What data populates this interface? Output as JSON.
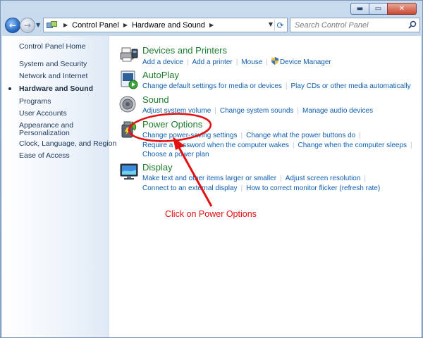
{
  "window": {
    "buttons": {
      "minimize": "▬",
      "maximize": "▭",
      "close": "✕"
    }
  },
  "address": {
    "crumbs": [
      "Control Panel",
      "Hardware and Sound"
    ],
    "search_placeholder": "Search Control Panel"
  },
  "sidebar": {
    "items": [
      {
        "label": "Control Panel Home"
      },
      {
        "label": "System and Security"
      },
      {
        "label": "Network and Internet"
      },
      {
        "label": "Hardware and Sound"
      },
      {
        "label": "Programs"
      },
      {
        "label": "User Accounts"
      },
      {
        "label": "Appearance and"
      },
      {
        "label": "Personalization"
      },
      {
        "label": "Clock, Language, and Region"
      },
      {
        "label": "Ease of Access"
      }
    ]
  },
  "categories": [
    {
      "title": "Devices and Printers",
      "icon": "printer-icon",
      "links": [
        "Add a device",
        "Add a printer",
        "Mouse",
        "Device Manager"
      ]
    },
    {
      "title": "AutoPlay",
      "icon": "autoplay-icon",
      "links": [
        "Change default settings for media or devices",
        "Play CDs or other media automatically"
      ]
    },
    {
      "title": "Sound",
      "icon": "speaker-icon",
      "links": [
        "Adjust system volume",
        "Change system sounds",
        "Manage audio devices"
      ]
    },
    {
      "title": "Power Options",
      "icon": "power-icon",
      "links": [
        "Change power-saving settings",
        "Change what the power buttons do",
        "Require a password when the computer wakes",
        "Change when the computer sleeps",
        "Choose a power plan"
      ]
    },
    {
      "title": "Display",
      "icon": "monitor-icon",
      "links": [
        "Make text and other items larger or smaller",
        "Adjust screen resolution",
        "Connect to an external display",
        "How to correct monitor flicker (refresh rate)"
      ]
    }
  ],
  "annotation": {
    "text": "Click on Power Options",
    "color": "#e21010"
  }
}
